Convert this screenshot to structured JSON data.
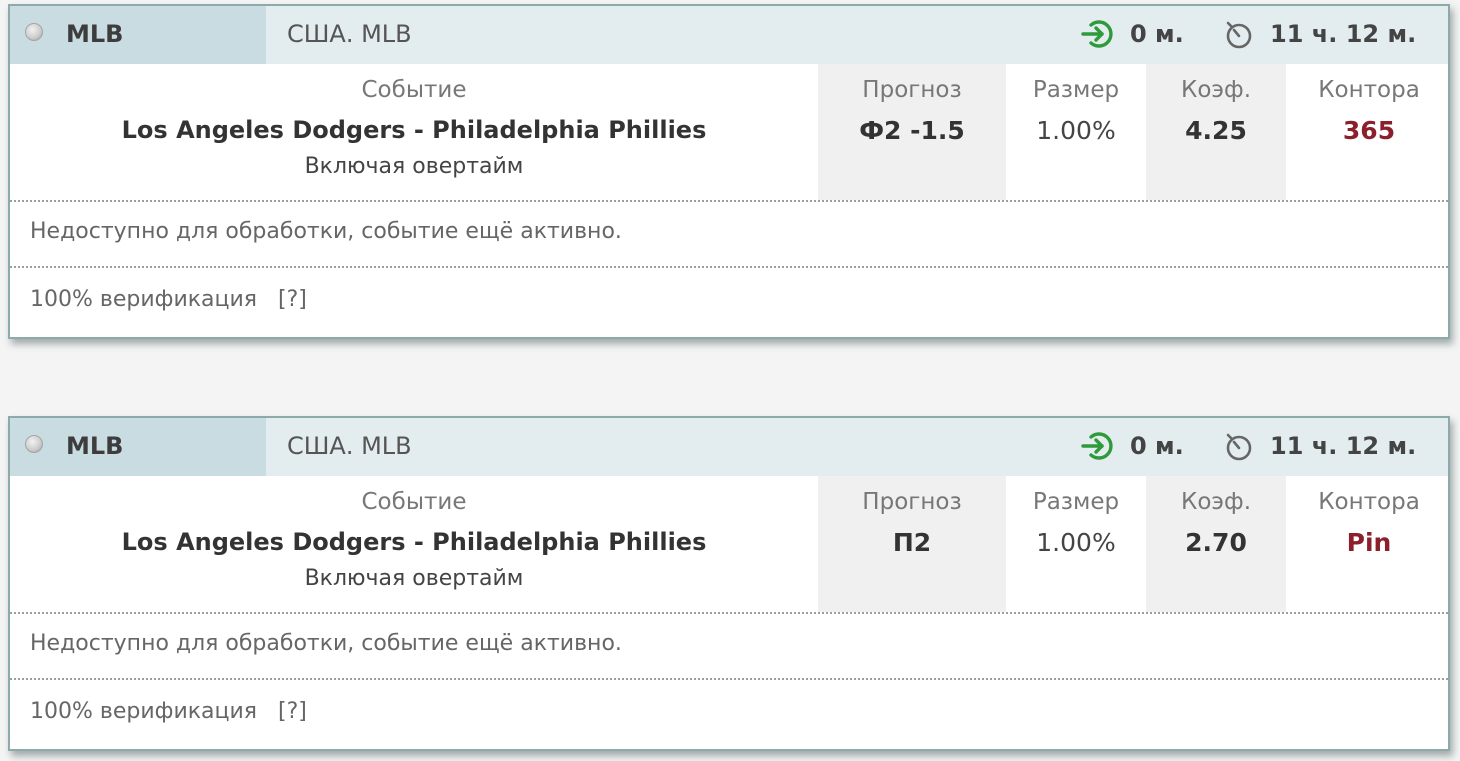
{
  "cards": [
    {
      "league": "MLB",
      "region": "США. MLB",
      "entry_time": "0 м.",
      "time_left": "11 ч. 12 м.",
      "event_label": "Событие",
      "event_name": "Los Angeles Dodgers - Philadelphia Phillies",
      "event_note": "Включая овертайм",
      "forecast_label": "Прогноз",
      "forecast": "Ф2 -1.5",
      "size_label": "Размер",
      "size": "1.00%",
      "coef_label": "Коэф.",
      "coef": "4.25",
      "book_label": "Контора",
      "bookmaker": "365",
      "status": "Недоступно для обработки, событие ещё активно.",
      "verification": "100% верификация",
      "help_link": "[?]"
    },
    {
      "league": "MLB",
      "region": "США. MLB",
      "entry_time": "0 м.",
      "time_left": "11 ч. 12 м.",
      "event_label": "Событие",
      "event_name": "Los Angeles Dodgers - Philadelphia Phillies",
      "event_note": "Включая овертайм",
      "forecast_label": "Прогноз",
      "forecast": "П2",
      "size_label": "Размер",
      "size": "1.00%",
      "coef_label": "Коэф.",
      "coef": "2.70",
      "book_label": "Контора",
      "bookmaker": "Pin",
      "status": "Недоступно для обработки, событие ещё активно.",
      "verification": "100% верификация",
      "help_link": "[?]"
    }
  ],
  "icons": {
    "entry": "enter-arrow-icon",
    "timer": "stopwatch-icon",
    "status_dot": "status-dot-icon"
  },
  "colors": {
    "header_bg": "#e3edef",
    "league_bg": "#c9dce1",
    "border": "#8ea9a9",
    "bookmaker": "#8b1f2b",
    "entry_icon": "#2e9a3a"
  }
}
